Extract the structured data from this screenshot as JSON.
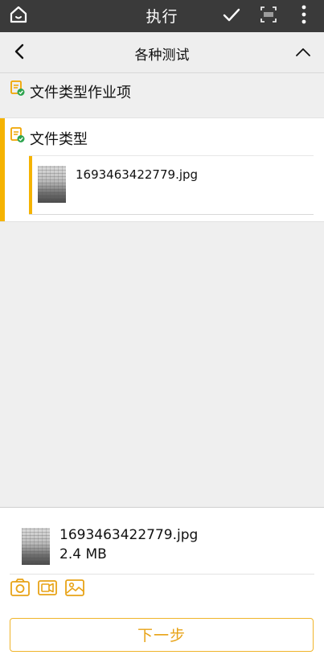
{
  "topbar": {
    "title": "执行",
    "icons": [
      "home-icon",
      "check-icon",
      "barcode-scan-icon",
      "more-vertical-icon"
    ]
  },
  "subheader": {
    "title": "各种测试",
    "icons": [
      "back-icon",
      "collapse-up-icon"
    ]
  },
  "items": [
    {
      "label": "文件类型作业项",
      "icon": "document-check-icon"
    }
  ],
  "section": {
    "label": "文件类型",
    "icon": "document-check-icon",
    "accent": "#f5b301",
    "files": [
      {
        "name": "1693463422779.jpg"
      }
    ]
  },
  "bottom": {
    "file": {
      "name": "1693463422779.jpg",
      "size": "2.4 MB"
    },
    "media_icons": [
      "camera-icon",
      "video-icon",
      "image-icon"
    ],
    "next_label": "下一步",
    "accent": "#e8a317"
  }
}
